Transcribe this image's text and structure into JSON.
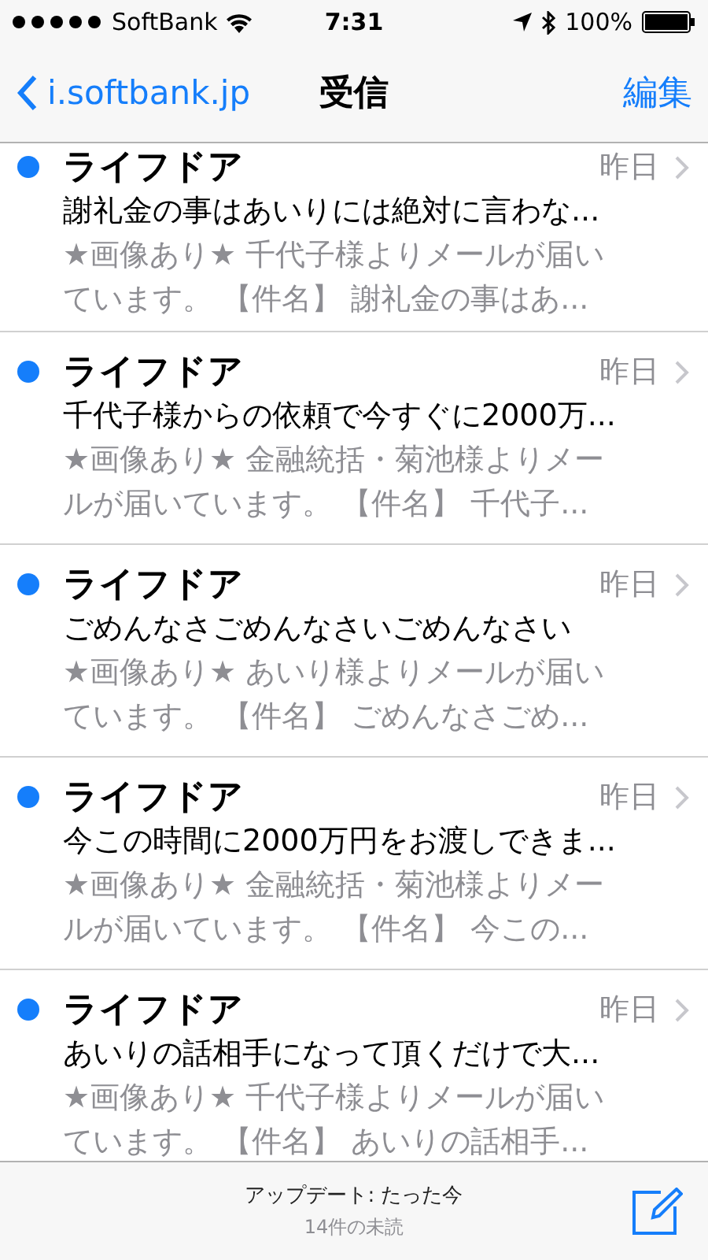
{
  "status_bar": {
    "carrier": "SoftBank",
    "time": "7:31",
    "battery": "100%"
  },
  "nav": {
    "back": "i.softbank.jp",
    "title": "受信",
    "action": "編集"
  },
  "messages": [
    {
      "sender": "ライフドア",
      "date": "昨日",
      "unread": true,
      "subject": "謝礼金の事はあいりには絶対に言わな...",
      "preview_lines": [
        "★画像あり★ 千代子様よりメールが届い",
        "ています。 【件名】 謝礼金の事はあ..."
      ]
    },
    {
      "sender": "ライフドア",
      "date": "昨日",
      "unread": true,
      "subject": "千代子様からの依頼で今すぐに2000万...",
      "preview_lines": [
        "★画像あり★ 金融統括・菊池様よりメー",
        "ルが届いています。 【件名】 千代子..."
      ]
    },
    {
      "sender": "ライフドア",
      "date": "昨日",
      "unread": true,
      "subject": "ごめんなさごめんなさいごめんなさい",
      "preview_lines": [
        "★画像あり★ あいり様よりメールが届い",
        "ています。 【件名】 ごめんなさごめ..."
      ]
    },
    {
      "sender": "ライフドア",
      "date": "昨日",
      "unread": true,
      "subject": "今この時間に2000万円をお渡しできま...",
      "preview_lines": [
        "★画像あり★ 金融統括・菊池様よりメー",
        "ルが届いています。 【件名】 今この..."
      ]
    },
    {
      "sender": "ライフドア",
      "date": "昨日",
      "unread": true,
      "subject": "あいりの話相手になって頂くだけで大...",
      "preview_lines": [
        "★画像あり★ 千代子様よりメールが届い",
        "ています。 【件名】 あいりの話相手..."
      ]
    }
  ],
  "toolbar": {
    "updated": "アップデート: たった今",
    "unread_count": "14件の未読"
  }
}
